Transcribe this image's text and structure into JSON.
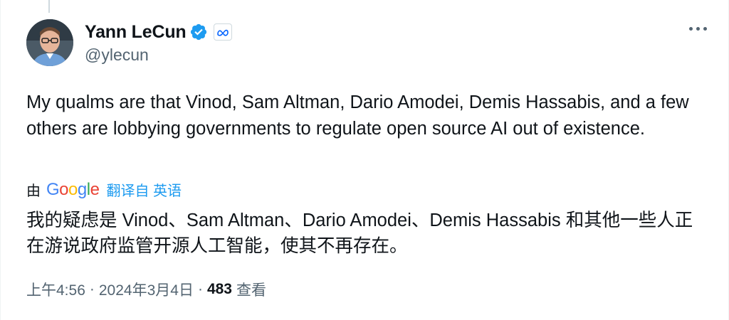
{
  "author": {
    "display_name": "Yann LeCun",
    "handle": "@ylecun"
  },
  "tweet": {
    "text": "My qualms are that Vinod, Sam Altman, Dario Amodei, Demis Hassabis, and a few others are lobbying governments to regulate open source AI out of existence."
  },
  "translation": {
    "by_label": "由",
    "provider_logo": {
      "letters": [
        "G",
        "o",
        "o",
        "g",
        "l",
        "e"
      ]
    },
    "link_text": "翻译自 英语",
    "text": "我的疑虑是 Vinod、Sam Altman、Dario Amodei、Demis Hassabis 和其他一些人正在游说政府监管开源人工智能，使其不再存在。"
  },
  "footer": {
    "time": "上午4:56",
    "separator": "·",
    "date": "2024年3月4日",
    "views_count": "483",
    "views_label": "查看"
  },
  "icons": {
    "verified": "verified-badge-icon",
    "affiliation": "meta-logo-icon",
    "more": "more-options-icon"
  },
  "colors": {
    "verified_blue": "#1d9bf0",
    "meta_blue": "#0866ff",
    "link_blue": "#1d9bf0",
    "secondary_text": "#536471",
    "primary_text": "#0f1419"
  }
}
